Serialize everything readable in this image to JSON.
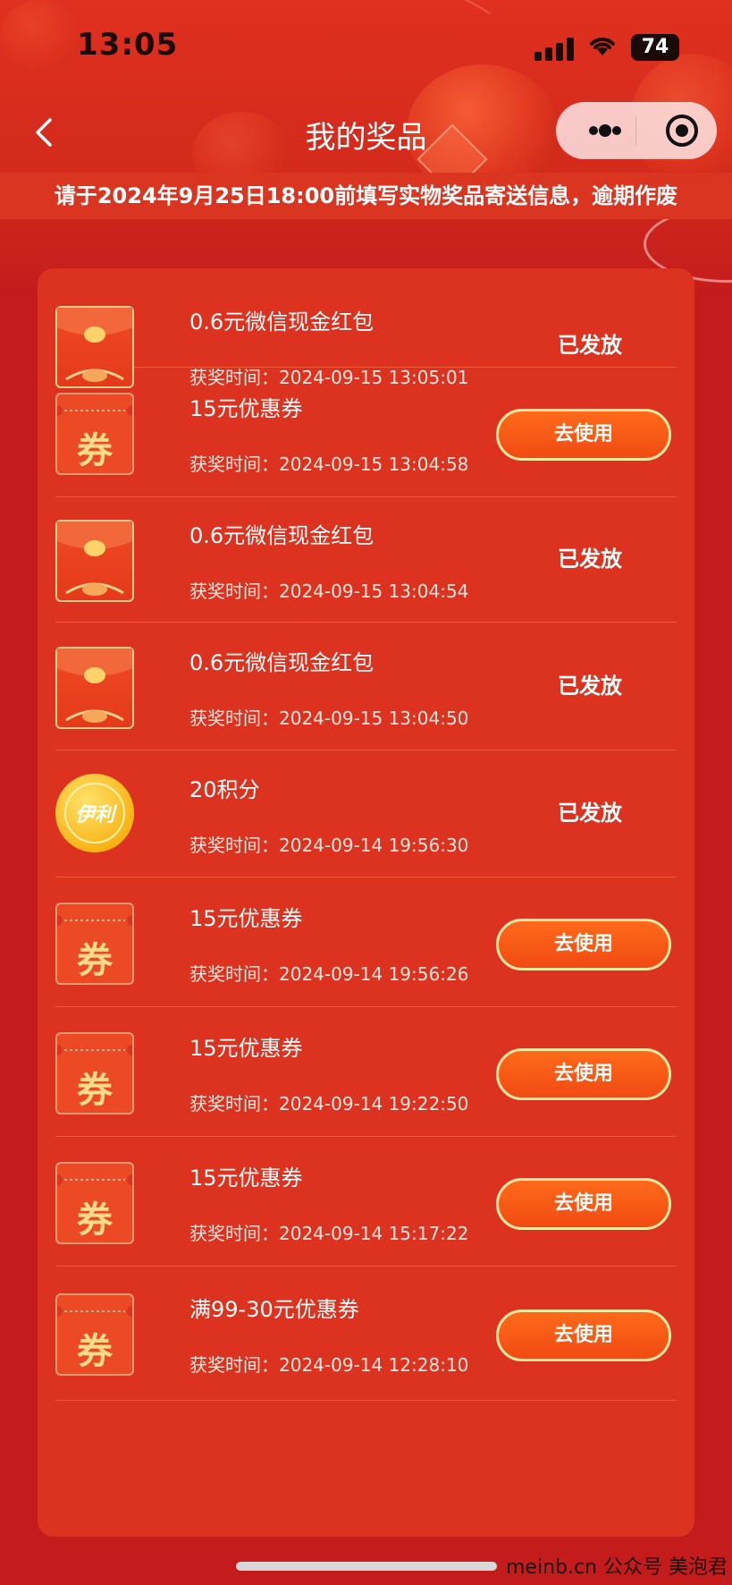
{
  "status_bar": {
    "time": "13:05",
    "battery": "74"
  },
  "nav": {
    "title": "我的奖品"
  },
  "notice": "请于2024年9月25日18:00前填写实物奖品寄送信息，逾期作废",
  "prizes": [
    {
      "name": "0.6元微信现金红包",
      "time": "获奖时间：2024-09-15 13:05:01",
      "status": "已发放",
      "type": "envelope"
    },
    {
      "name": "15元优惠券",
      "time": "获奖时间：2024-09-15 13:04:58",
      "action": "去使用",
      "type": "coupon",
      "coupon_char": "券"
    },
    {
      "name": "0.6元微信现金红包",
      "time": "获奖时间：2024-09-15 13:04:54",
      "status": "已发放",
      "type": "envelope"
    },
    {
      "name": "0.6元微信现金红包",
      "time": "获奖时间：2024-09-15 13:04:50",
      "status": "已发放",
      "type": "envelope"
    },
    {
      "name": "20积分",
      "time": "获奖时间：2024-09-14 19:56:30",
      "status": "已发放",
      "type": "coin",
      "coin_text": "伊利"
    },
    {
      "name": "15元优惠券",
      "time": "获奖时间：2024-09-14 19:56:26",
      "action": "去使用",
      "type": "coupon",
      "coupon_char": "券"
    },
    {
      "name": "15元优惠券",
      "time": "获奖时间：2024-09-14 19:22:50",
      "action": "去使用",
      "type": "coupon",
      "coupon_char": "券"
    },
    {
      "name": "15元优惠券",
      "time": "获奖时间：2024-09-14 15:17:22",
      "action": "去使用",
      "type": "coupon",
      "coupon_char": "券"
    },
    {
      "name": "满99-30元优惠券",
      "time": "获奖时间：2024-09-14 12:28:10",
      "action": "去使用",
      "type": "coupon",
      "coupon_char": "券"
    }
  ],
  "watermark": "meinb.cn 公众号 美泡君",
  "colors": {
    "accent": "#dc3320",
    "button": "#f04b12",
    "button_border": "#ffe8a0"
  }
}
